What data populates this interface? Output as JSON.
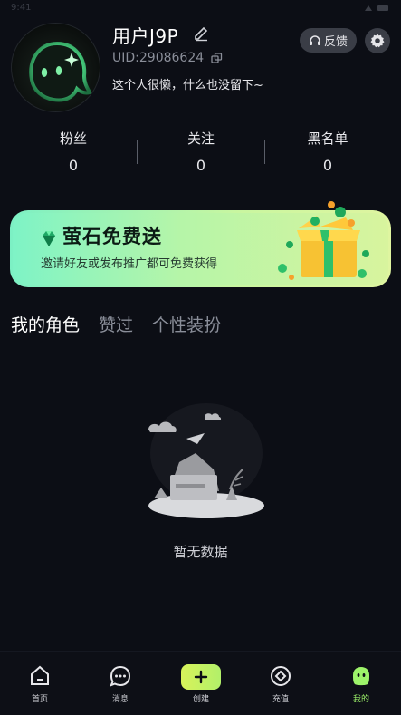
{
  "status_bar": {
    "time": "9:41"
  },
  "profile": {
    "name": "用户J9P",
    "uid": "UID:29086624",
    "bio": "这个人很懒，什么也没留下~"
  },
  "header": {
    "feedback_label": "反馈"
  },
  "stats": [
    {
      "label": "粉丝",
      "value": "0"
    },
    {
      "label": "关注",
      "value": "0"
    },
    {
      "label": "黑名单",
      "value": "0"
    }
  ],
  "promo": {
    "title": "萤石免费送",
    "subtitle": "邀请好友或发布推广都可免费获得"
  },
  "tabs": [
    {
      "label": "我的角色",
      "active": true
    },
    {
      "label": "赞过",
      "active": false
    },
    {
      "label": "个性装扮",
      "active": false
    }
  ],
  "empty_state": {
    "text": "暂无数据"
  },
  "bottom_nav": [
    {
      "label": "首页",
      "icon": "home-icon"
    },
    {
      "label": "消息",
      "icon": "message-icon"
    },
    {
      "label": "创建",
      "icon": "plus-icon"
    },
    {
      "label": "充值",
      "icon": "recharge-icon"
    },
    {
      "label": "我的",
      "icon": "profile-icon",
      "active": true
    }
  ],
  "colors": {
    "background": "#0c0e15",
    "accent_green": "#9df36a",
    "chip_gray": "#3a3d46"
  }
}
